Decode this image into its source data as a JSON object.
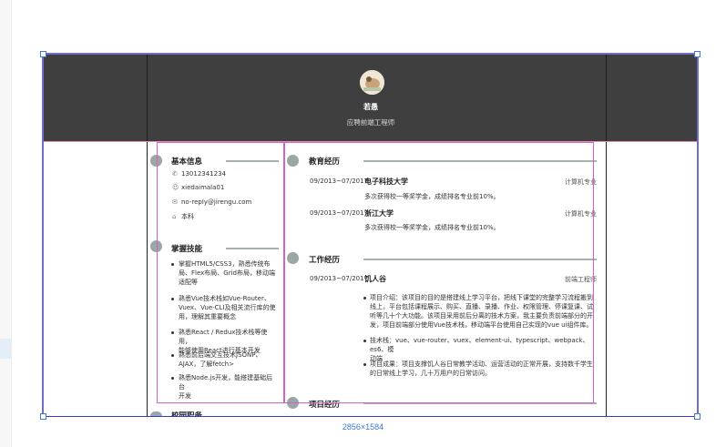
{
  "canvas": {
    "dimensions_label": "2856×1584"
  },
  "header": {
    "name": "若愚",
    "subtitle": "应聘前端工程师"
  },
  "basic_info": {
    "title": "基本信息",
    "items": [
      {
        "icon": "phone-icon",
        "text": "13012341234"
      },
      {
        "icon": "wechat-icon",
        "text": "xiedaimala01"
      },
      {
        "icon": "email-icon",
        "text": "no-reply@jirengu.com"
      },
      {
        "icon": "graduation-cap-icon",
        "text": "本科"
      }
    ]
  },
  "skills": {
    "title": "掌握技能",
    "items": [
      {
        "lines": [
          "掌握HTML5/CSS3，熟悉传统布",
          "局、Flex布局、Grid布局，移动端",
          "适配等"
        ]
      },
      {
        "lines": [
          "熟悉Vue技术栈如Vue-Router、",
          "Vuex、Vue-CLI及相关流行库的使",
          "用，理解其重要概念"
        ]
      },
      {
        "lines": [
          "熟悉React / Redux技术栈等使用，",
          "能够使用React进行基本开发"
        ]
      },
      {
        "lines": [
          "熟悉前后端交互技术JSONP、",
          "AJAX，了解fetch>"
        ]
      },
      {
        "lines": [
          "熟悉Node.js开发，能搭建基础后台",
          "开发"
        ]
      }
    ],
    "next_section_partial": "校园职务"
  },
  "education": {
    "title": "教育经历",
    "entries": [
      {
        "date": "09/2013~07/2017",
        "school": "电子科技大学",
        "major": "计算机专业",
        "desc": "多次获得校一等奖学金，成绩排名专业前10%。"
      },
      {
        "date": "09/2013~07/2017",
        "school": "浙江大学",
        "major": "计算机专业",
        "desc": "多次获得校一等奖学金，成绩排名专业前10%。"
      }
    ]
  },
  "work": {
    "title": "工作经历",
    "entry": {
      "date": "09/2013~07/2017",
      "company": "饥人谷",
      "role": "前端工程师",
      "items": [
        {
          "lines": [
            "项目介绍：该项目的目的是搭建线上学习平台，把线下课堂的完整学习流程搬到",
            "线上，平台包括课程展示、购买、直播、录播、作业、权限管理、停课复课、试",
            "听等几十个大功能。该项目采用前后分离的技术方案，我主要负责前端部分的开",
            "发，项目前端部分使用Vue技术栈，移动端平台使用自己实现的vue ui组件库。"
          ]
        },
        {
          "lines": [
            "技术栈：vue、vue-router、vuex、element-ui、typescript、webpack、es6、模",
            "动端"
          ]
        },
        {
          "lines": [
            "项目成果：项目支撑饥人谷日常教学活动、运营活动的正常开展，支持数千学生",
            "的日常线上学习，几十万用户的日常访问。"
          ]
        }
      ]
    }
  },
  "projects": {
    "title": "项目经历"
  },
  "colors": {
    "header_bg": "#3f3f3f",
    "selection_pink": "#d162c8",
    "frame_blue": "#3a7bd5",
    "icon_circle": "#9aa7a6"
  }
}
